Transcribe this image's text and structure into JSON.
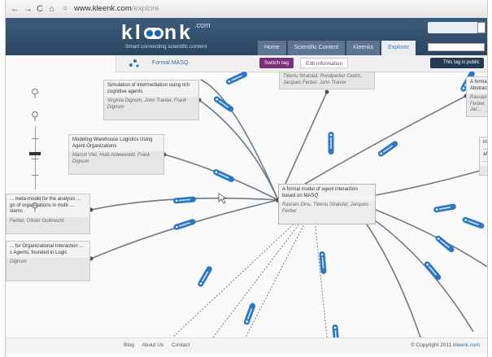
{
  "browser": {
    "url_host": "www.kleenk.com",
    "url_path": "/explore"
  },
  "site": {
    "logo": "kl",
    "logo_end": "nk",
    "logo_com": ".com",
    "tagline": "Smart connecting scientific content"
  },
  "nav": {
    "tabs": [
      "Home",
      "Scientific Content",
      "Kleenks",
      "Explorer"
    ]
  },
  "tagbar": {
    "tag_name": "Formal MASQ",
    "switch": "Switch tag",
    "edit": "Edit information",
    "public": "This tag is public"
  },
  "cards": [
    {
      "title": "Simulation of intermediation using rich cognitive agents",
      "authors": "Virginia Dignum, John Tranier, Frank Dignum"
    },
    {
      "title": "",
      "authors": "Tiberiu Stratulat, Rondperlier Cedric, Jacques Ferber, John Tranier"
    },
    {
      "title": "A formal ... Abstract ...",
      "authors": "Rasrain ... Ferber, Jac..."
    },
    {
      "title": "Modeling Warehouse Logistics Using Agent Organizations",
      "authors": "Marcel Viet, Huib Aldewereld, Frank Dignum"
    },
    {
      "title": "... meta-model for the analysis ... gn of organizations in multi- ... stems",
      "authors": "Ferber, Olivier Gutknecht"
    },
    {
      "title": "A formal model of agent interaction based on MASQ",
      "authors": "Rasrain Dinu, Tiberiu Stratulat, Jacques Ferber"
    },
    {
      "title": "... for Organizational Interaction ... s Agents, founded in Logic",
      "authors": "Dignum"
    },
    {
      "title": "info ... afte ...",
      "authors": ""
    }
  ],
  "footer": {
    "links": [
      "Blog",
      "About Us",
      "Contact"
    ],
    "copyright": "© Copyright 2011 ",
    "copyright_site": "kleenk.com"
  },
  "colors": {
    "header": "#2f4d6c",
    "tag_pill": "#2b77c8",
    "switch_button": "#7a2f7a"
  }
}
